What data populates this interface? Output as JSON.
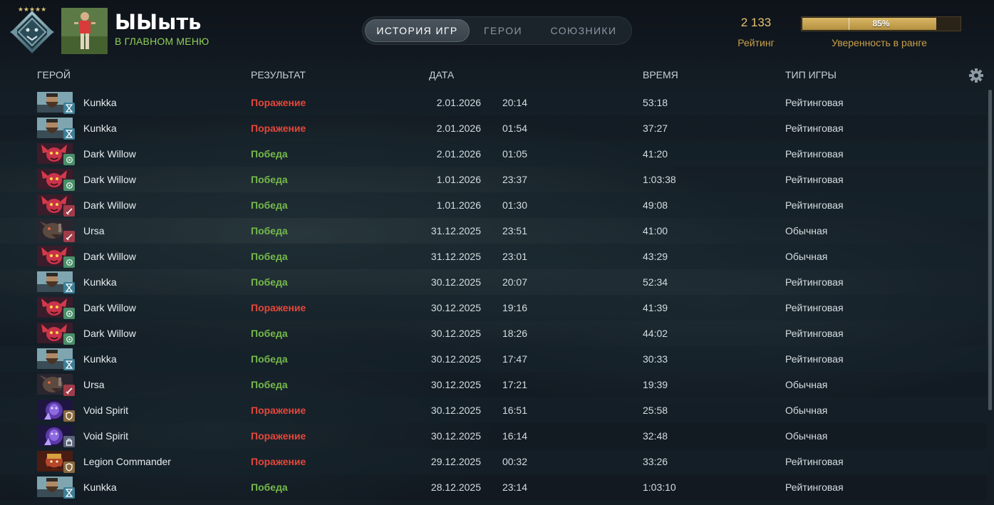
{
  "profile": {
    "rank_stars": "★★★★★",
    "name": "ЫЫыть",
    "status": "В ГЛАВНОМ МЕНЮ"
  },
  "tabs": [
    {
      "label": "ИСТОРИЯ ИГР",
      "active": true
    },
    {
      "label": "ГЕРОИ",
      "active": false
    },
    {
      "label": "СОЮЗНИКИ",
      "active": false
    }
  ],
  "rating": {
    "value": "2 133",
    "label": "Рейтинг"
  },
  "confidence": {
    "percent_text": "85%",
    "fraction": 0.85,
    "label": "Уверенность в ранге"
  },
  "columns": {
    "hero": "ГЕРОЙ",
    "result": "РЕЗУЛЬТАТ",
    "date": "ДАТА",
    "duration": "ВРЕМЯ",
    "game_type": "ТИП ИГРЫ"
  },
  "colors": {
    "loss": "#e5473a",
    "win": "#75b94b",
    "gold": "#c8a04a"
  },
  "matches": [
    {
      "hero": "Kunkka",
      "hero_icon": "kunkka-portrait",
      "role_icon": "hourglass-icon",
      "result": "Поражение",
      "outcome": "loss",
      "date": "2.01.2026",
      "time": "20:14",
      "duration": "53:18",
      "type": "Рейтинговая"
    },
    {
      "hero": "Kunkka",
      "hero_icon": "kunkka-portrait",
      "role_icon": "hourglass-icon",
      "result": "Поражение",
      "outcome": "loss",
      "date": "2.01.2026",
      "time": "01:54",
      "duration": "37:27",
      "type": "Рейтинговая"
    },
    {
      "hero": "Dark Willow",
      "hero_icon": "dark-willow-portrait",
      "role_icon": "swirl-icon",
      "result": "Победа",
      "outcome": "win",
      "date": "2.01.2026",
      "time": "01:05",
      "duration": "41:20",
      "type": "Рейтинговая"
    },
    {
      "hero": "Dark Willow",
      "hero_icon": "dark-willow-portrait",
      "role_icon": "swirl-icon",
      "result": "Победа",
      "outcome": "win",
      "date": "1.01.2026",
      "time": "23:37",
      "duration": "1:03:38",
      "type": "Рейтинговая"
    },
    {
      "hero": "Dark Willow",
      "hero_icon": "dark-willow-portrait",
      "role_icon": "sword-icon",
      "result": "Победа",
      "outcome": "win",
      "date": "1.01.2026",
      "time": "01:30",
      "duration": "49:08",
      "type": "Рейтинговая"
    },
    {
      "hero": "Ursa",
      "hero_icon": "ursa-portrait",
      "role_icon": "sword-icon",
      "result": "Победа",
      "outcome": "win",
      "date": "31.12.2025",
      "time": "23:51",
      "duration": "41:00",
      "type": "Обычная"
    },
    {
      "hero": "Dark Willow",
      "hero_icon": "dark-willow-portrait",
      "role_icon": "swirl-icon",
      "result": "Победа",
      "outcome": "win",
      "date": "31.12.2025",
      "time": "23:01",
      "duration": "43:29",
      "type": "Обычная"
    },
    {
      "hero": "Kunkka",
      "hero_icon": "kunkka-portrait",
      "role_icon": "hourglass-icon",
      "result": "Победа",
      "outcome": "win",
      "date": "30.12.2025",
      "time": "20:07",
      "duration": "52:34",
      "type": "Рейтинговая"
    },
    {
      "hero": "Dark Willow",
      "hero_icon": "dark-willow-portrait",
      "role_icon": "swirl-icon",
      "result": "Поражение",
      "outcome": "loss",
      "date": "30.12.2025",
      "time": "19:16",
      "duration": "41:39",
      "type": "Рейтинговая"
    },
    {
      "hero": "Dark Willow",
      "hero_icon": "dark-willow-portrait",
      "role_icon": "swirl-icon",
      "result": "Победа",
      "outcome": "win",
      "date": "30.12.2025",
      "time": "18:26",
      "duration": "44:02",
      "type": "Рейтинговая"
    },
    {
      "hero": "Kunkka",
      "hero_icon": "kunkka-portrait",
      "role_icon": "hourglass-icon",
      "result": "Победа",
      "outcome": "win",
      "date": "30.12.2025",
      "time": "17:47",
      "duration": "30:33",
      "type": "Рейтинговая"
    },
    {
      "hero": "Ursa",
      "hero_icon": "ursa-portrait",
      "role_icon": "sword-icon",
      "result": "Победа",
      "outcome": "win",
      "date": "30.12.2025",
      "time": "17:21",
      "duration": "19:39",
      "type": "Обычная"
    },
    {
      "hero": "Void Spirit",
      "hero_icon": "void-spirit-portrait",
      "role_icon": "shield-icon",
      "result": "Поражение",
      "outcome": "loss",
      "date": "30.12.2025",
      "time": "16:51",
      "duration": "25:58",
      "type": "Обычная"
    },
    {
      "hero": "Void Spirit",
      "hero_icon": "void-spirit-portrait",
      "role_icon": "lock-icon",
      "result": "Поражение",
      "outcome": "loss",
      "date": "30.12.2025",
      "time": "16:14",
      "duration": "32:48",
      "type": "Обычная"
    },
    {
      "hero": "Legion Commander",
      "hero_icon": "legion-commander-portrait",
      "role_icon": "shield-icon",
      "result": "Поражение",
      "outcome": "loss",
      "date": "29.12.2025",
      "time": "00:32",
      "duration": "33:26",
      "type": "Рейтинговая"
    },
    {
      "hero": "Kunkka",
      "hero_icon": "kunkka-portrait",
      "role_icon": "hourglass-icon",
      "result": "Победа",
      "outcome": "win",
      "date": "28.12.2025",
      "time": "23:14",
      "duration": "1:03:10",
      "type": "Рейтинговая"
    }
  ]
}
